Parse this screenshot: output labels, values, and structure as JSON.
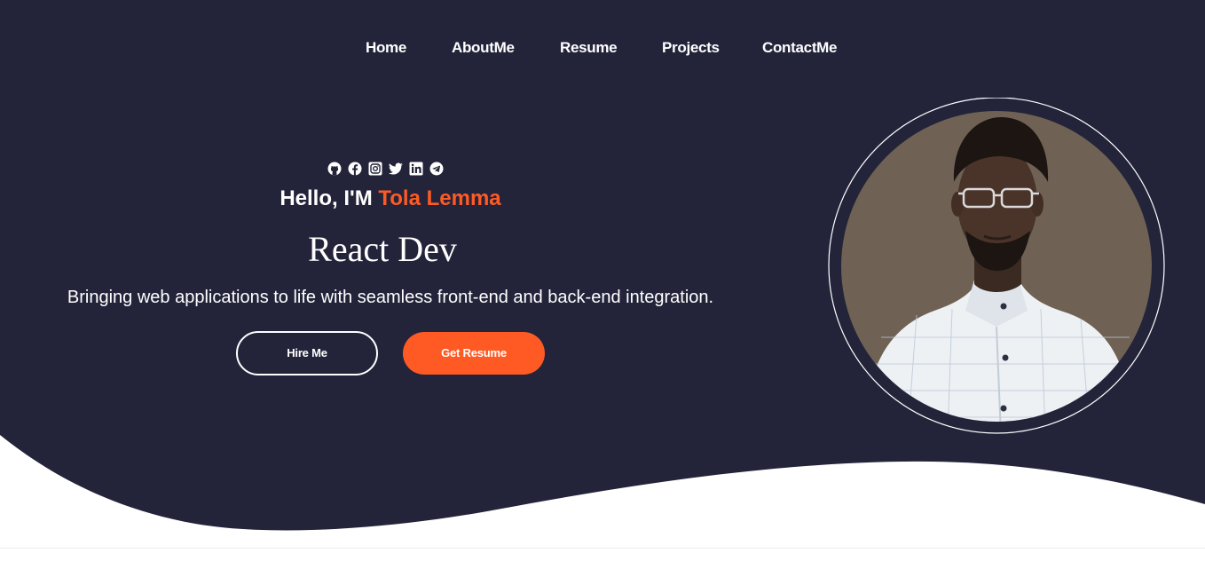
{
  "nav": {
    "items": [
      {
        "label": "Home"
      },
      {
        "label": "AboutMe"
      },
      {
        "label": "Resume"
      },
      {
        "label": "Projects"
      },
      {
        "label": "ContactMe"
      }
    ]
  },
  "social": {
    "icons": [
      "github-icon",
      "facebook-icon",
      "instagram-icon",
      "twitter-icon",
      "linkedin-icon",
      "telegram-icon"
    ]
  },
  "hero": {
    "greeting_prefix": "Hello, I'M",
    "name": "Tola Lemma",
    "role": "React Dev",
    "tagline": "Bringing web applications to life with seamless front-end and back-end integration.",
    "hire_label": "Hire Me",
    "resume_label": "Get Resume"
  },
  "colors": {
    "background": "#23243a",
    "accent": "#ff5a24",
    "text": "#ffffff",
    "photo_background": "#6f6254"
  }
}
